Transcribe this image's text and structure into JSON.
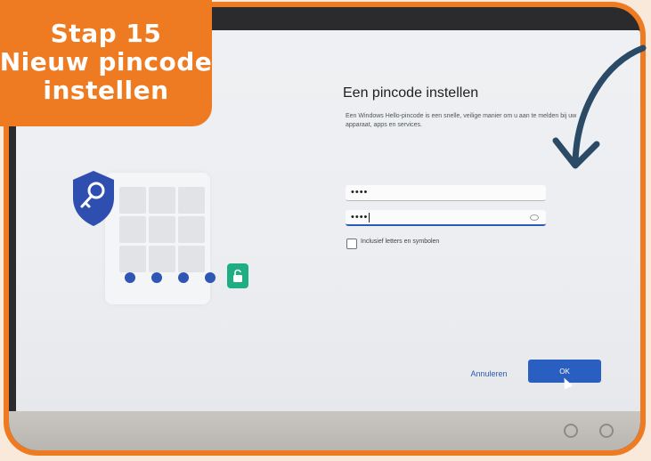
{
  "callout": {
    "lines": [
      "Stap 15",
      "Nieuw pincode",
      "instellen"
    ]
  },
  "dialog": {
    "title": "Een pincode instellen",
    "description": "Een Windows Hello-pincode is een snelle, veilige manier om u aan te melden bij uw apparaat, apps en services.",
    "pin_field": {
      "value": "••••"
    },
    "confirm_field": {
      "value": "••••"
    },
    "checkbox_label": "Inclusief letters en symbolen",
    "checkbox_checked": false,
    "cancel_label": "Annuleren",
    "ok_label": "OK"
  },
  "colors": {
    "accent_orange": "#ee7a22",
    "windows_blue": "#2a5fc2",
    "lock_green": "#1fae83",
    "arrow": "#2b4a66"
  },
  "icons": [
    "key-shield-icon",
    "unlock-icon",
    "eye-icon",
    "arrow-icon",
    "mouse-cursor-icon"
  ]
}
